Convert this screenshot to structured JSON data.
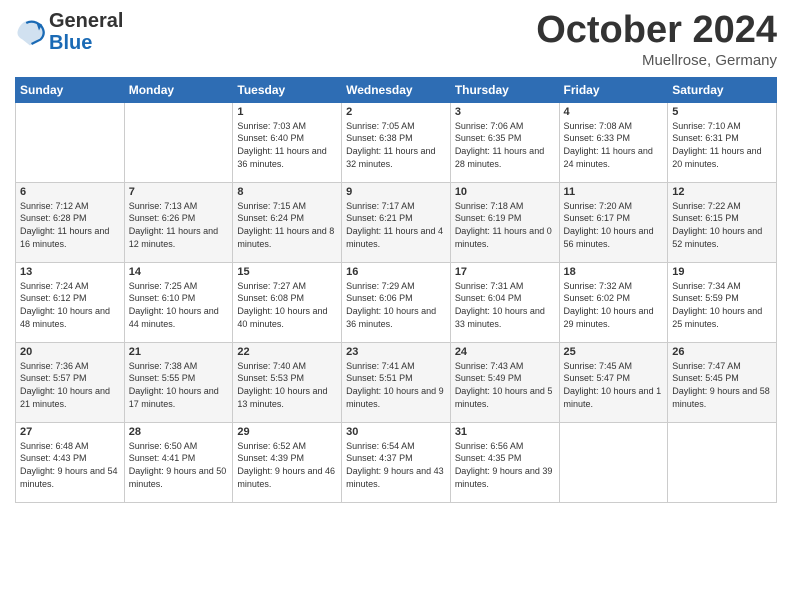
{
  "logo": {
    "line1": "General",
    "line2": "Blue"
  },
  "title": "October 2024",
  "location": "Muellrose, Germany",
  "days_header": [
    "Sunday",
    "Monday",
    "Tuesday",
    "Wednesday",
    "Thursday",
    "Friday",
    "Saturday"
  ],
  "weeks": [
    [
      {
        "day": "",
        "info": ""
      },
      {
        "day": "",
        "info": ""
      },
      {
        "day": "1",
        "info": "Sunrise: 7:03 AM\nSunset: 6:40 PM\nDaylight: 11 hours and 36 minutes."
      },
      {
        "day": "2",
        "info": "Sunrise: 7:05 AM\nSunset: 6:38 PM\nDaylight: 11 hours and 32 minutes."
      },
      {
        "day": "3",
        "info": "Sunrise: 7:06 AM\nSunset: 6:35 PM\nDaylight: 11 hours and 28 minutes."
      },
      {
        "day": "4",
        "info": "Sunrise: 7:08 AM\nSunset: 6:33 PM\nDaylight: 11 hours and 24 minutes."
      },
      {
        "day": "5",
        "info": "Sunrise: 7:10 AM\nSunset: 6:31 PM\nDaylight: 11 hours and 20 minutes."
      }
    ],
    [
      {
        "day": "6",
        "info": "Sunrise: 7:12 AM\nSunset: 6:28 PM\nDaylight: 11 hours and 16 minutes."
      },
      {
        "day": "7",
        "info": "Sunrise: 7:13 AM\nSunset: 6:26 PM\nDaylight: 11 hours and 12 minutes."
      },
      {
        "day": "8",
        "info": "Sunrise: 7:15 AM\nSunset: 6:24 PM\nDaylight: 11 hours and 8 minutes."
      },
      {
        "day": "9",
        "info": "Sunrise: 7:17 AM\nSunset: 6:21 PM\nDaylight: 11 hours and 4 minutes."
      },
      {
        "day": "10",
        "info": "Sunrise: 7:18 AM\nSunset: 6:19 PM\nDaylight: 11 hours and 0 minutes."
      },
      {
        "day": "11",
        "info": "Sunrise: 7:20 AM\nSunset: 6:17 PM\nDaylight: 10 hours and 56 minutes."
      },
      {
        "day": "12",
        "info": "Sunrise: 7:22 AM\nSunset: 6:15 PM\nDaylight: 10 hours and 52 minutes."
      }
    ],
    [
      {
        "day": "13",
        "info": "Sunrise: 7:24 AM\nSunset: 6:12 PM\nDaylight: 10 hours and 48 minutes."
      },
      {
        "day": "14",
        "info": "Sunrise: 7:25 AM\nSunset: 6:10 PM\nDaylight: 10 hours and 44 minutes."
      },
      {
        "day": "15",
        "info": "Sunrise: 7:27 AM\nSunset: 6:08 PM\nDaylight: 10 hours and 40 minutes."
      },
      {
        "day": "16",
        "info": "Sunrise: 7:29 AM\nSunset: 6:06 PM\nDaylight: 10 hours and 36 minutes."
      },
      {
        "day": "17",
        "info": "Sunrise: 7:31 AM\nSunset: 6:04 PM\nDaylight: 10 hours and 33 minutes."
      },
      {
        "day": "18",
        "info": "Sunrise: 7:32 AM\nSunset: 6:02 PM\nDaylight: 10 hours and 29 minutes."
      },
      {
        "day": "19",
        "info": "Sunrise: 7:34 AM\nSunset: 5:59 PM\nDaylight: 10 hours and 25 minutes."
      }
    ],
    [
      {
        "day": "20",
        "info": "Sunrise: 7:36 AM\nSunset: 5:57 PM\nDaylight: 10 hours and 21 minutes."
      },
      {
        "day": "21",
        "info": "Sunrise: 7:38 AM\nSunset: 5:55 PM\nDaylight: 10 hours and 17 minutes."
      },
      {
        "day": "22",
        "info": "Sunrise: 7:40 AM\nSunset: 5:53 PM\nDaylight: 10 hours and 13 minutes."
      },
      {
        "day": "23",
        "info": "Sunrise: 7:41 AM\nSunset: 5:51 PM\nDaylight: 10 hours and 9 minutes."
      },
      {
        "day": "24",
        "info": "Sunrise: 7:43 AM\nSunset: 5:49 PM\nDaylight: 10 hours and 5 minutes."
      },
      {
        "day": "25",
        "info": "Sunrise: 7:45 AM\nSunset: 5:47 PM\nDaylight: 10 hours and 1 minute."
      },
      {
        "day": "26",
        "info": "Sunrise: 7:47 AM\nSunset: 5:45 PM\nDaylight: 9 hours and 58 minutes."
      }
    ],
    [
      {
        "day": "27",
        "info": "Sunrise: 6:48 AM\nSunset: 4:43 PM\nDaylight: 9 hours and 54 minutes."
      },
      {
        "day": "28",
        "info": "Sunrise: 6:50 AM\nSunset: 4:41 PM\nDaylight: 9 hours and 50 minutes."
      },
      {
        "day": "29",
        "info": "Sunrise: 6:52 AM\nSunset: 4:39 PM\nDaylight: 9 hours and 46 minutes."
      },
      {
        "day": "30",
        "info": "Sunrise: 6:54 AM\nSunset: 4:37 PM\nDaylight: 9 hours and 43 minutes."
      },
      {
        "day": "31",
        "info": "Sunrise: 6:56 AM\nSunset: 4:35 PM\nDaylight: 9 hours and 39 minutes."
      },
      {
        "day": "",
        "info": ""
      },
      {
        "day": "",
        "info": ""
      }
    ]
  ]
}
